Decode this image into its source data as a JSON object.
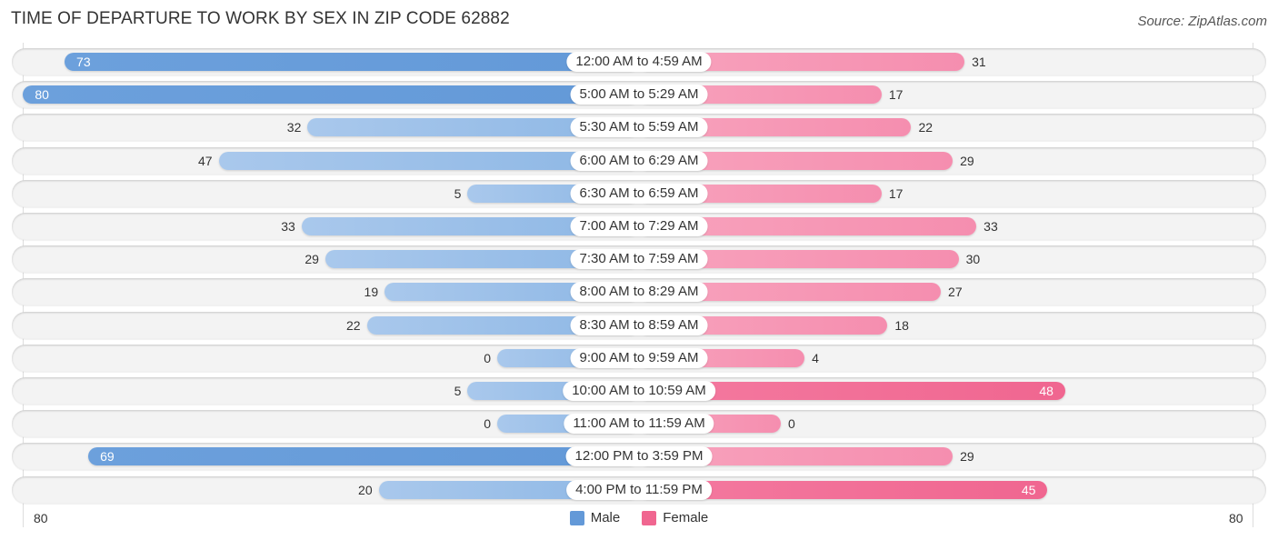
{
  "title": "TIME OF DEPARTURE TO WORK BY SEX IN ZIP CODE 62882",
  "source": "Source: ZipAtlas.com",
  "colors": {
    "male": "#6399d8",
    "male_light": "#8db7e5",
    "female": "#f06690",
    "female_light": "#f58eaf"
  },
  "chart_data": {
    "type": "bar",
    "orientation": "horizontal-diverging",
    "title": "TIME OF DEPARTURE TO WORK BY SEX IN ZIP CODE 62882",
    "categories": [
      "12:00 AM to 4:59 AM",
      "5:00 AM to 5:29 AM",
      "5:30 AM to 5:59 AM",
      "6:00 AM to 6:29 AM",
      "6:30 AM to 6:59 AM",
      "7:00 AM to 7:29 AM",
      "7:30 AM to 7:59 AM",
      "8:00 AM to 8:29 AM",
      "8:30 AM to 8:59 AM",
      "9:00 AM to 9:59 AM",
      "10:00 AM to 10:59 AM",
      "11:00 AM to 11:59 AM",
      "12:00 PM to 3:59 PM",
      "4:00 PM to 11:59 PM"
    ],
    "series": [
      {
        "name": "Male",
        "values": [
          73,
          80,
          32,
          47,
          5,
          33,
          29,
          19,
          22,
          0,
          5,
          0,
          69,
          20
        ]
      },
      {
        "name": "Female",
        "values": [
          31,
          17,
          22,
          29,
          17,
          33,
          30,
          27,
          18,
          4,
          48,
          0,
          29,
          45
        ]
      }
    ],
    "xlim": [
      -80,
      80
    ],
    "tick_labels": {
      "left": "80",
      "right": "80"
    },
    "legend": {
      "position": "bottom-center",
      "entries": [
        "Male",
        "Female"
      ]
    },
    "grid": false
  }
}
